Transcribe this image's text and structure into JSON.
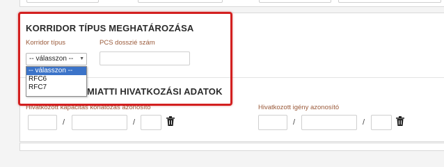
{
  "section_corridor": {
    "title": "KORRIDOR TÍPUS MEGHATÁROZÁSA",
    "corridor_type_label": "Korridor típus",
    "pcs_label": "PCS dosszié szám",
    "corridor_select_value": "-- válasszon --",
    "pcs_value": ""
  },
  "dropdown": {
    "options": [
      "-- válasszon --",
      "RFC6",
      "RFC7"
    ],
    "selected_index": 0
  },
  "section_references": {
    "title_visible_part": "MIATTI HIVATKOZÁSI ADATOK",
    "capacity_label": "Hivatkozott kapacitás korlátozás azonosító",
    "request_label": "Hivatkozott igény azonosító",
    "separator": "/"
  },
  "colors": {
    "highlight": "#d31f1f",
    "label": "#9a5a3a",
    "selected_option": "#3b73c8"
  },
  "icons": [
    "trash-icon",
    "chevron-down-icon"
  ]
}
